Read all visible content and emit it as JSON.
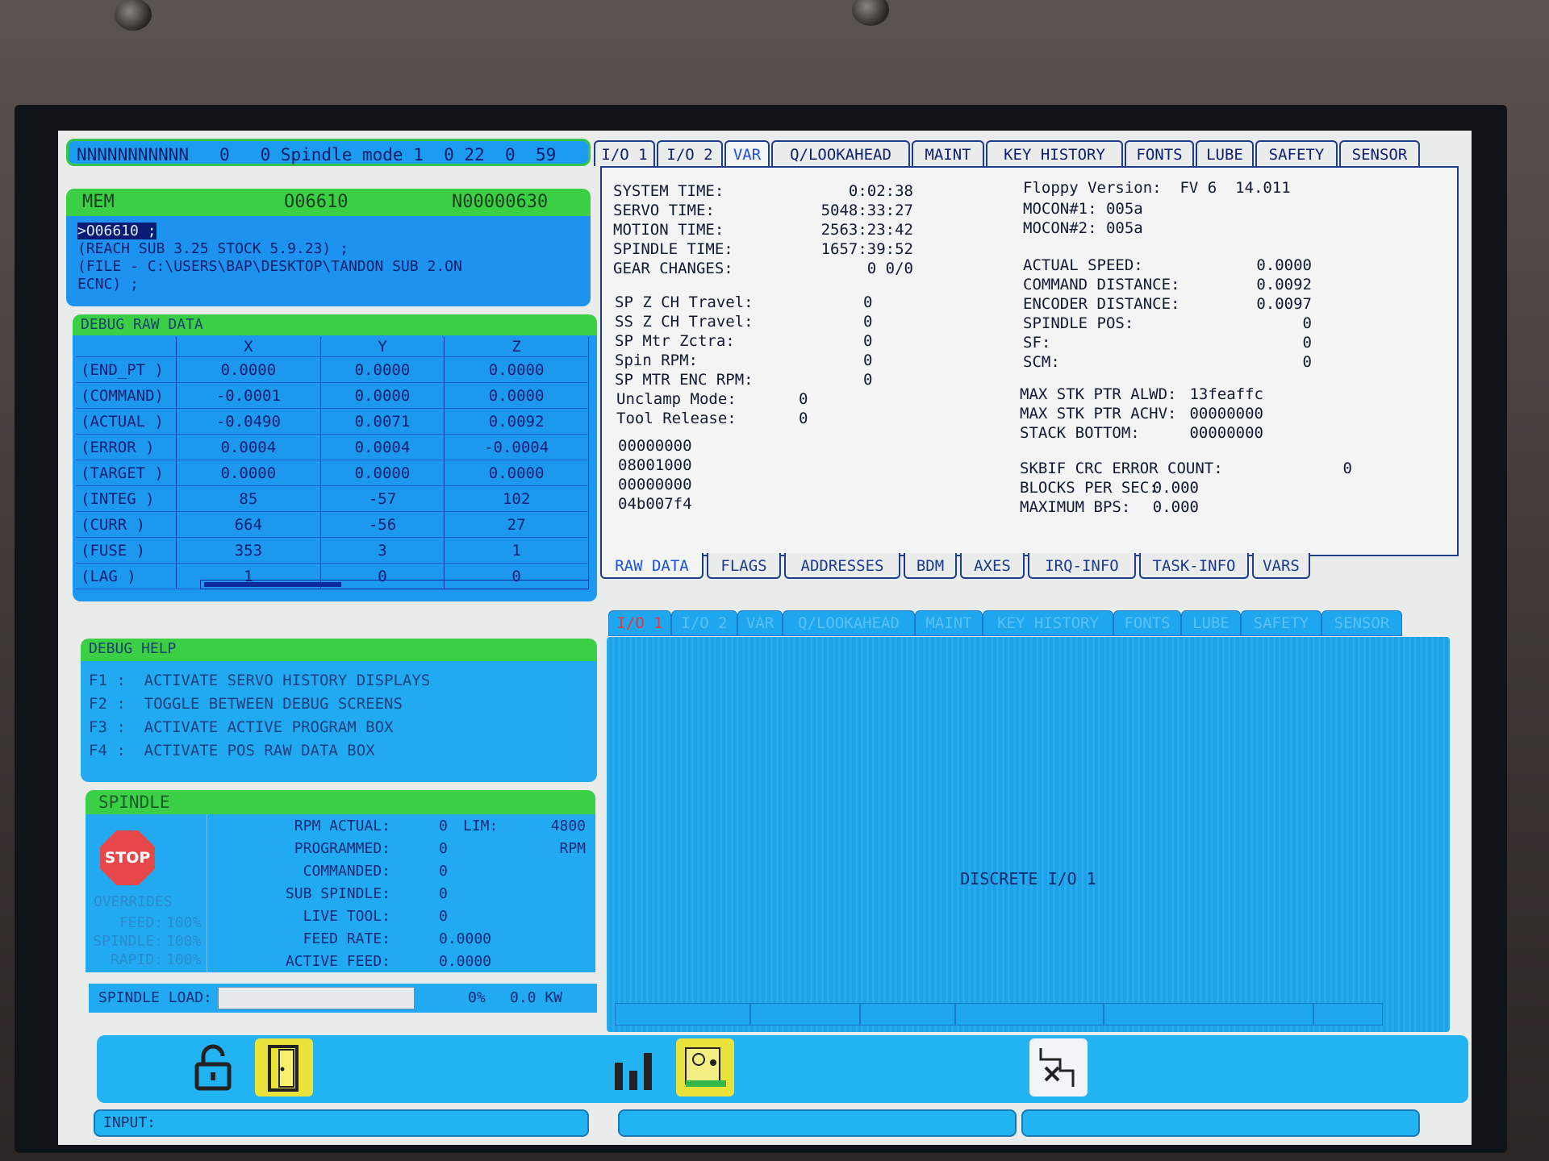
{
  "status_bar": "NNNNNNNNNNN   0   0 Spindle mode 1  0 22  0  59",
  "mem": {
    "mode": "MEM",
    "program": "O06610",
    "block": "N00000630"
  },
  "program_lines": [
    ">O06610 ;",
    "(REACH SUB 3.25 STOCK 5.9.23) ;",
    "(FILE - C:\\USERS\\BAP\\DESKTOP\\TANDON SUB 2.ON",
    "ECNC) ;"
  ],
  "debug_raw": {
    "title": "DEBUG RAW DATA",
    "columns": [
      "X",
      "Y",
      "Z"
    ],
    "rows": [
      {
        "label": "(END_PT )",
        "x": "0.0000",
        "y": "0.0000",
        "z": "0.0000"
      },
      {
        "label": "(COMMAND)",
        "x": "-0.0001",
        "y": "0.0000",
        "z": "0.0000"
      },
      {
        "label": "(ACTUAL )",
        "x": "-0.0490",
        "y": "0.0071",
        "z": "0.0092"
      },
      {
        "label": "(ERROR  )",
        "x": "0.0004",
        "y": "0.0004",
        "z": "-0.0004"
      },
      {
        "label": "(TARGET )",
        "x": "0.0000",
        "y": "0.0000",
        "z": "0.0000"
      },
      {
        "label": "(INTEG  )",
        "x": "85",
        "y": "-57",
        "z": "102"
      },
      {
        "label": "(CURR   )",
        "x": "664",
        "y": "-56",
        "z": "27"
      },
      {
        "label": "(FUSE   )",
        "x": "353",
        "y": "3",
        "z": "1"
      },
      {
        "label": "(LAG    )",
        "x": "1",
        "y": "0",
        "z": "0"
      }
    ]
  },
  "debug_help": {
    "title": "DEBUG HELP",
    "lines": [
      "F1 :  ACTIVATE SERVO HISTORY DISPLAYS",
      "F2 :  TOGGLE BETWEEN DEBUG SCREENS",
      "F3 :  ACTIVATE ACTIVE PROGRAM BOX",
      "F4 :  ACTIVATE POS RAW DATA BOX"
    ]
  },
  "spindle": {
    "title": "SPINDLE",
    "stop_label": "STOP",
    "overrides_title": "OVERRIDES",
    "overrides": [
      {
        "label": "FEED:",
        "value": "100%"
      },
      {
        "label": "SPINDLE:",
        "value": "100%"
      },
      {
        "label": "RAPID:",
        "value": "100%"
      }
    ],
    "rows": [
      {
        "label": "RPM ACTUAL:",
        "value": "0",
        "extra": "LIM:",
        "extra2": "4800"
      },
      {
        "label": "PROGRAMMED:",
        "value": "0",
        "extra": "",
        "extra2": "RPM"
      },
      {
        "label": "COMMANDED:",
        "value": "0",
        "extra": "",
        "extra2": ""
      },
      {
        "label": "SUB SPINDLE:",
        "value": "0",
        "extra": "",
        "extra2": ""
      },
      {
        "label": "LIVE TOOL:",
        "value": "0",
        "extra": "",
        "extra2": ""
      },
      {
        "label": "FEED RATE:",
        "value": "0.0000",
        "extra": "",
        "extra2": ""
      },
      {
        "label": "ACTIVE FEED:",
        "value": "0.0000",
        "extra": "",
        "extra2": ""
      }
    ],
    "load_label": "SPINDLE LOAD:",
    "load_percent": "0%",
    "load_kw": "0.0 KW"
  },
  "top_tabs": [
    "I/O 1",
    "I/O 2",
    "VAR",
    "Q/LOOKAHEAD",
    "MAINT",
    "KEY HISTORY",
    "FONTS",
    "LUBE",
    "SAFETY",
    "SENSOR"
  ],
  "top_active_tab": "VAR",
  "times": [
    {
      "label": "SYSTEM TIME:",
      "value": "0:02:38"
    },
    {
      "label": "SERVO TIME:",
      "value": "5048:33:27"
    },
    {
      "label": "MOTION TIME:",
      "value": "2563:23:42"
    },
    {
      "label": "SPINDLE TIME:",
      "value": "1657:39:52"
    },
    {
      "label": "GEAR CHANGES:",
      "value": "0 0/0"
    }
  ],
  "sp_values": [
    {
      "label": "SP Z CH Travel:",
      "value": "0"
    },
    {
      "label": "SS Z CH Travel:",
      "value": "0"
    },
    {
      "label": "SP Mtr Zctra:",
      "value": "0"
    },
    {
      "label": "Spin RPM:",
      "value": "0"
    },
    {
      "label": "SP MTR ENC RPM:",
      "value": "0"
    }
  ],
  "unclamp": [
    {
      "label": "Unclamp Mode:",
      "value": "0"
    },
    {
      "label": "Tool Release:",
      "value": "0"
    }
  ],
  "hex_values": [
    "00000000",
    "08001000",
    "00000000",
    "04b007f4"
  ],
  "version": {
    "floppy": "Floppy Version:  FV 6  14.011",
    "mocon1": "MOCON#1: 005a",
    "mocon2": "MOCON#2: 005a"
  },
  "motion": [
    {
      "label": "ACTUAL SPEED:",
      "value": "0.0000"
    },
    {
      "label": "COMMAND DISTANCE:",
      "value": "0.0092"
    },
    {
      "label": "ENCODER DISTANCE:",
      "value": "0.0097"
    },
    {
      "label": "SPINDLE POS:",
      "value": "0"
    },
    {
      "label": "SF:",
      "value": "0"
    },
    {
      "label": "SCM:",
      "value": "0"
    }
  ],
  "stack": [
    {
      "label": "MAX STK PTR ALWD:",
      "value": "13feaffc"
    },
    {
      "label": "MAX STK PTR ACHV:",
      "value": "00000000"
    },
    {
      "label": "STACK BOTTOM:",
      "value": "00000000"
    }
  ],
  "skbif": [
    {
      "label": "SKBIF CRC ERROR COUNT:",
      "value": "0"
    },
    {
      "label": "BLOCKS PER SEC:",
      "value": "0.000"
    },
    {
      "label": "MAXIMUM BPS:",
      "value": "0.000"
    }
  ],
  "bottom_tabs": [
    "RAW DATA",
    "FLAGS",
    "ADDRESSES",
    "BDM",
    "AXES",
    "IRQ-INFO",
    "TASK-INFO",
    "VARS"
  ],
  "bottom_active_tab": "RAW DATA",
  "io_tabs": [
    "I/O 1",
    "I/O 2",
    "VAR",
    "Q/LOOKAHEAD",
    "MAINT",
    "KEY HISTORY",
    "FONTS",
    "LUBE",
    "SAFETY",
    "SENSOR"
  ],
  "io_active_tab": "I/O 1",
  "io_title": "DISCRETE I/O 1",
  "io_bottom_tabs": [
    "",
    "",
    "",
    "",
    "",
    ""
  ],
  "input_label": "INPUT:",
  "colors": {
    "screen_blue": "#1c98ee",
    "header_green": "#3bcf45",
    "toolbar": "#22b4f2"
  }
}
